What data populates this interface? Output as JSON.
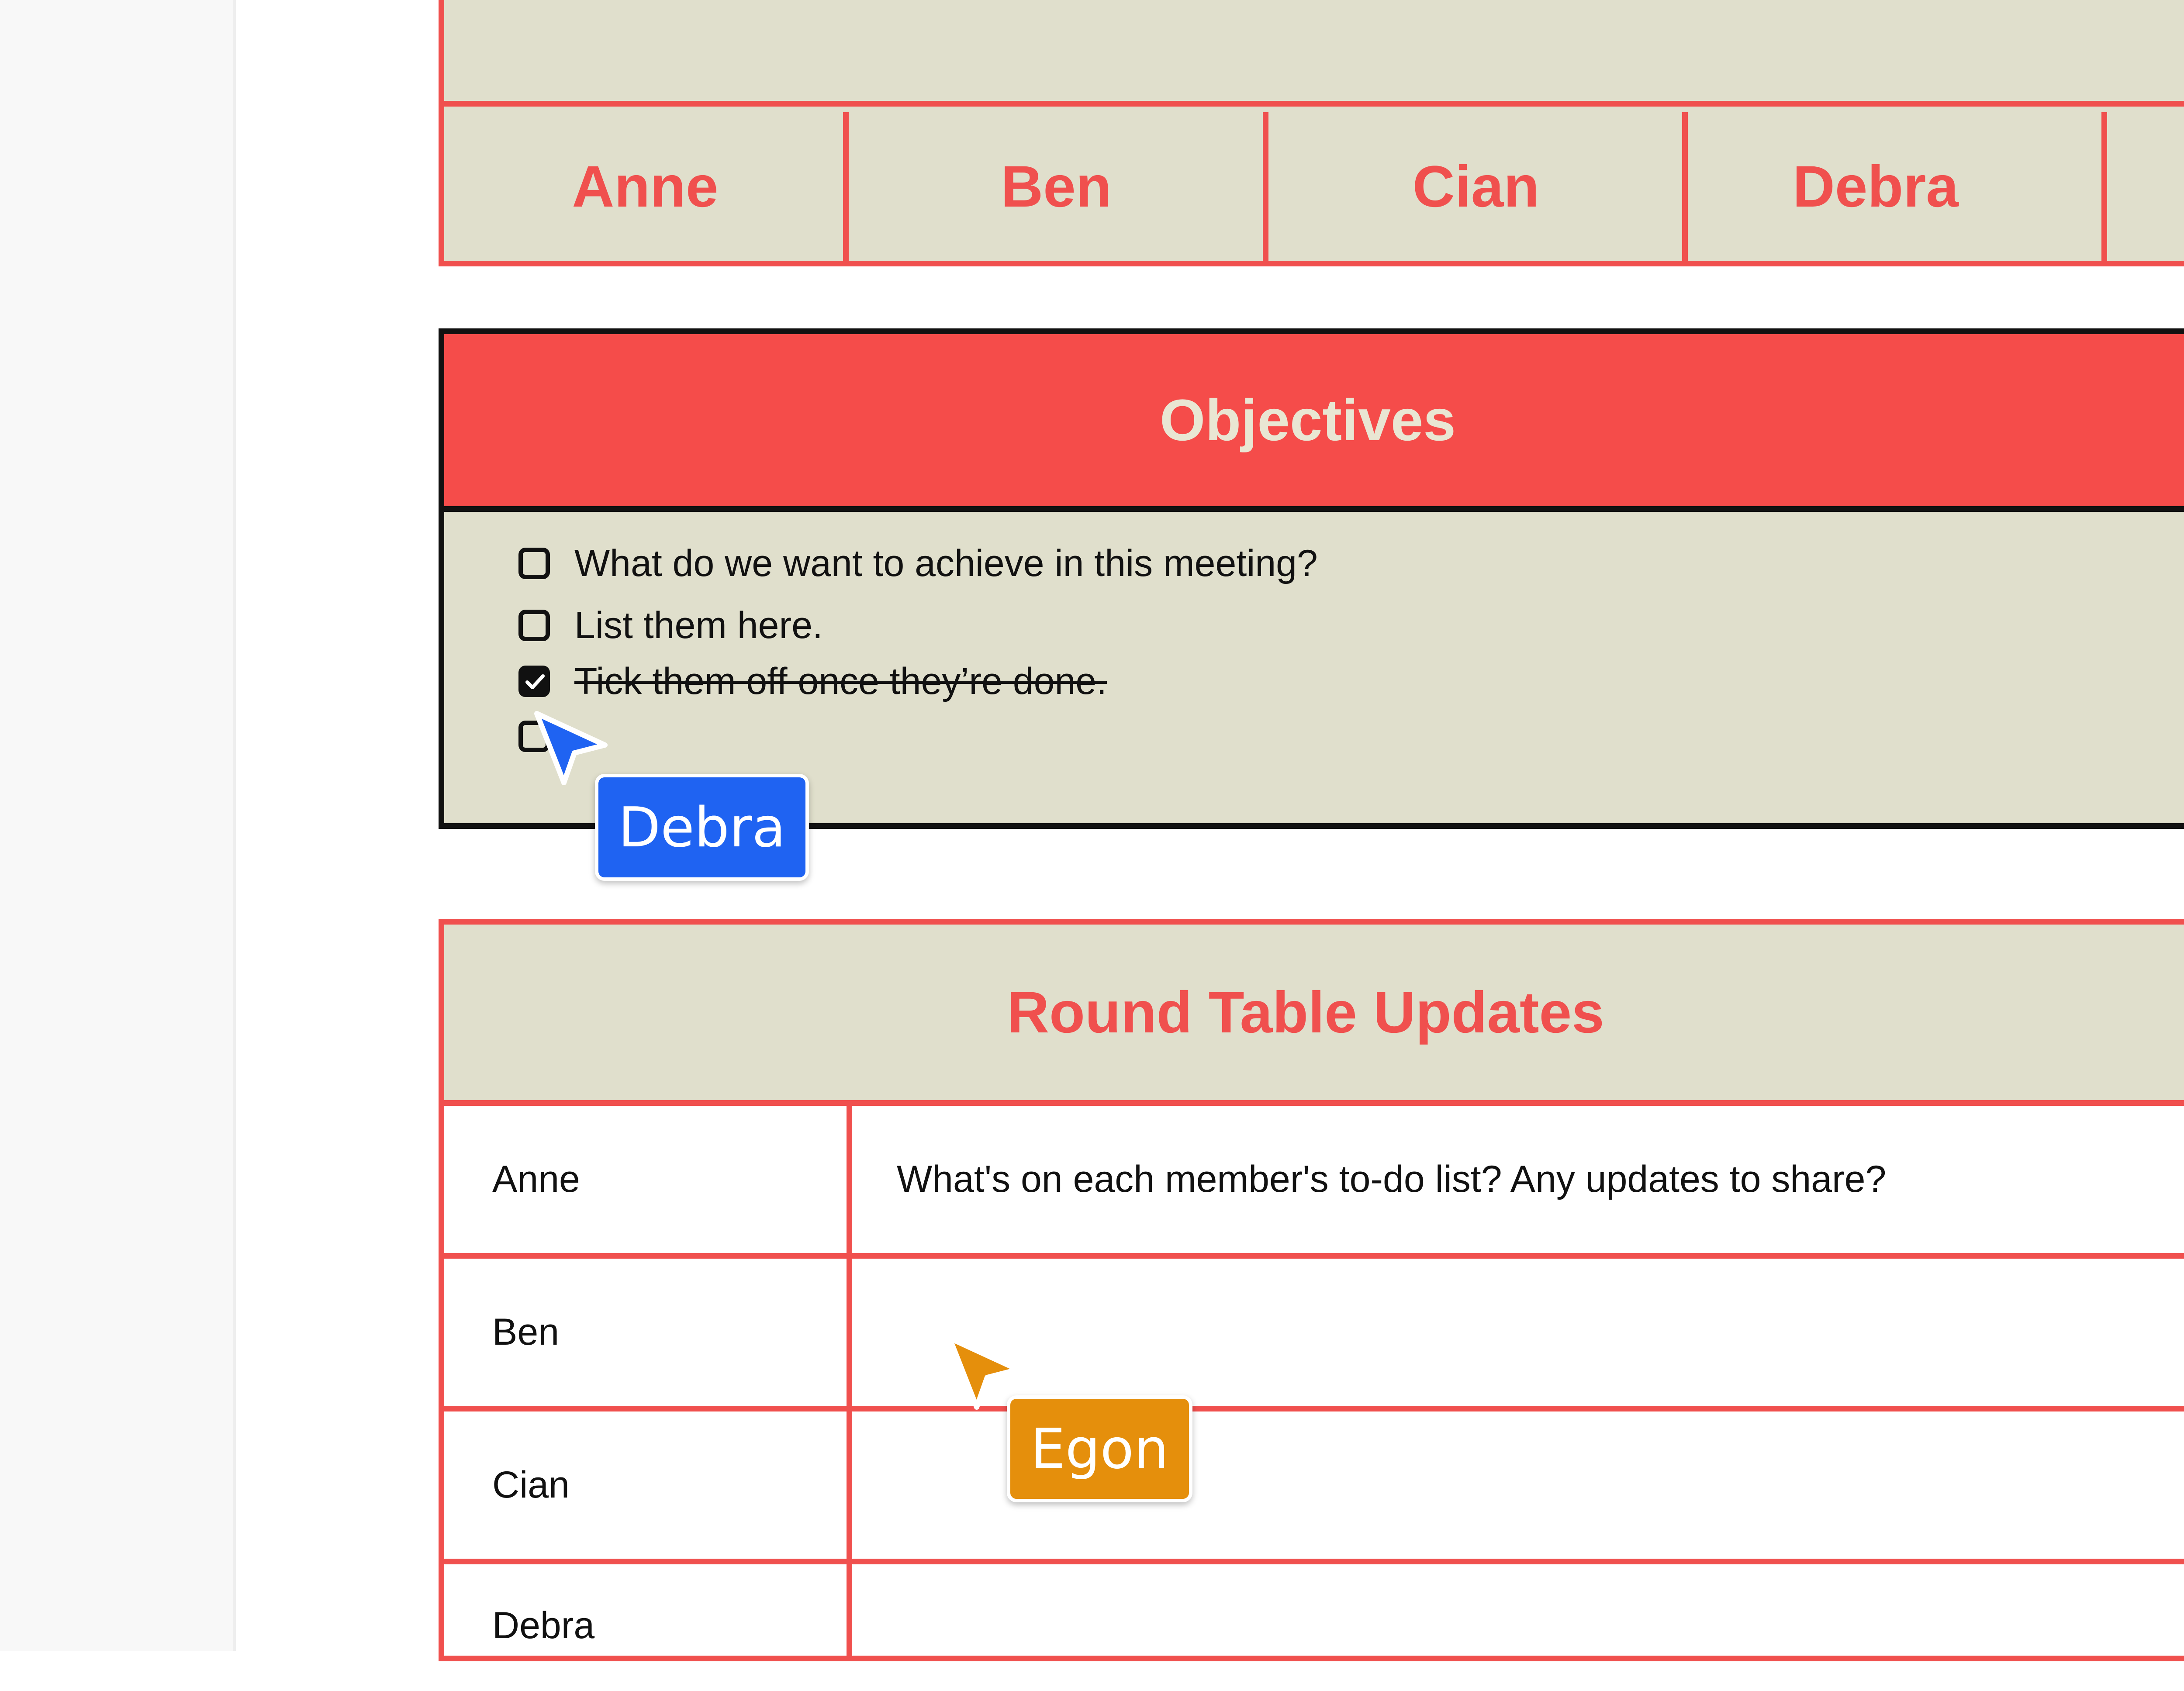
{
  "colors": {
    "accent_red": "#f0504e",
    "header_red": "#f54c4a",
    "beige": "#e0dfcc",
    "debra_cursor": "#1f63f2",
    "egon_cursor": "#e58f0c"
  },
  "participants": {
    "names": [
      "Anne",
      "Ben",
      "Cian",
      "Debra"
    ]
  },
  "objectives": {
    "title": "Objectives",
    "items": [
      {
        "text": "What do we want to achieve in this meeting?",
        "checked": false
      },
      {
        "text": "List them here.",
        "checked": false
      },
      {
        "text": "Tick them off once they’re done.",
        "checked": true
      },
      {
        "text": "",
        "checked": false
      }
    ]
  },
  "round_table": {
    "title": "Round Table Updates",
    "rows": [
      {
        "name": "Anne",
        "update": "What's on each member's to-do list? Any updates to share?"
      },
      {
        "name": "Ben",
        "update": ""
      },
      {
        "name": "Cian",
        "update": ""
      },
      {
        "name": "Debra",
        "update": ""
      }
    ]
  },
  "cursors": [
    {
      "user": "Debra",
      "icon": "pointer-arrow-icon"
    },
    {
      "user": "Egon",
      "icon": "pointer-arrow-icon"
    }
  ]
}
